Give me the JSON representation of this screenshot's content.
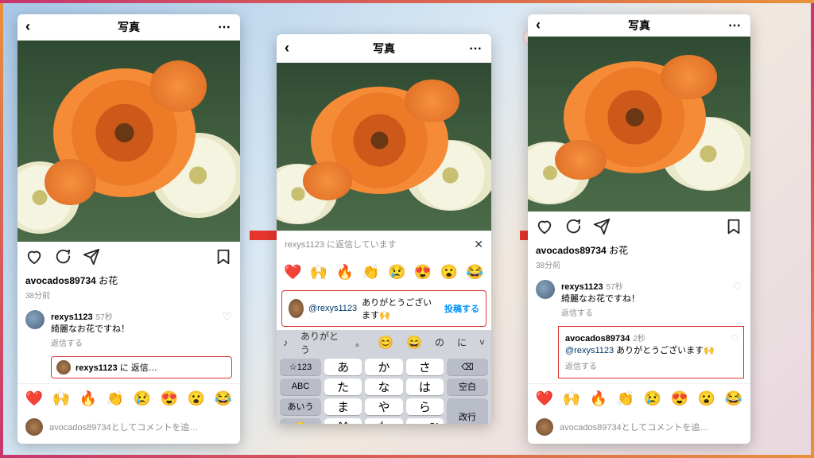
{
  "header": {
    "title": "写真",
    "back_glyph": "‹",
    "dots_glyph": "⋯"
  },
  "post": {
    "username": "avocados89734",
    "caption": "お花",
    "age": "38分前"
  },
  "comment1": {
    "username": "rexys1123",
    "age": "57秒",
    "text": "綺麗なお花ですね！",
    "reply_label": "返信する"
  },
  "reply_inline": {
    "prefix_user": "rexys1123",
    "suffix": "に 返信…"
  },
  "emoji_row": [
    "❤️",
    "🙌",
    "🔥",
    "👏",
    "😢",
    "😍",
    "😮",
    "😂"
  ],
  "add_comment_placeholder": "avocados89734としてコメントを追…",
  "replying_bar": {
    "text": "rexys1123 に返信しています",
    "close": "✕"
  },
  "compose": {
    "mention": "@rexys1123",
    "text": "ありがとうございます🙌",
    "post_label": "投稿する"
  },
  "keyboard": {
    "suggestions": [
      "♪",
      "ありがとう",
      "。",
      "😊",
      "😄",
      "の",
      "に"
    ],
    "fn_col": [
      "☆123",
      "ABC",
      "あいう",
      "😀"
    ],
    "grid": [
      [
        "あ",
        "か",
        "さ"
      ],
      [
        "た",
        "な",
        "は"
      ],
      [
        "ま",
        "や",
        "ら"
      ],
      [
        "^^",
        "わ",
        "、。?!"
      ]
    ],
    "right_col": [
      "⌫",
      "空白",
      "改行"
    ],
    "chevron": "˅"
  },
  "nested_reply": {
    "username": "avocados89734",
    "age": "2秒",
    "mention": "@rexys1123",
    "text": "ありがとうございます🙌",
    "reply_label": "返信する"
  }
}
